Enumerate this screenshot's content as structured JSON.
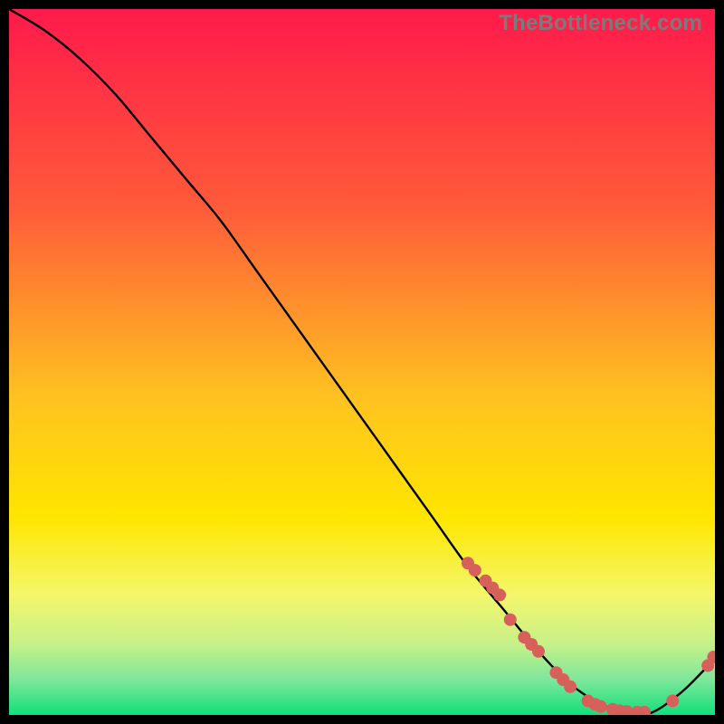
{
  "watermark": "TheBottleneck.com",
  "colors": {
    "gradient_top": "#ff1a4b",
    "gradient_mid1": "#ff6a33",
    "gradient_mid2": "#ffd400",
    "gradient_mid3": "#fff400",
    "gradient_bottom": "#10e07a",
    "curve": "#000000",
    "dot": "#d8605b"
  },
  "chart_data": {
    "type": "line",
    "title": "",
    "xlabel": "",
    "ylabel": "",
    "xlim": [
      0,
      100
    ],
    "ylim": [
      0,
      100
    ],
    "series": [
      {
        "name": "bottleneck-curve",
        "x": [
          0,
          5,
          10,
          15,
          20,
          25,
          30,
          35,
          40,
          45,
          50,
          55,
          60,
          65,
          70,
          75,
          80,
          85,
          90,
          95,
          100
        ],
        "y": [
          100,
          97,
          93,
          88,
          82,
          76,
          70,
          63,
          56,
          49,
          42,
          35,
          28,
          21,
          15,
          9,
          4,
          1,
          0,
          3,
          8
        ]
      }
    ],
    "markers": [
      {
        "x": 65.0,
        "y": 21.5
      },
      {
        "x": 66.0,
        "y": 20.5
      },
      {
        "x": 67.5,
        "y": 19.0
      },
      {
        "x": 68.5,
        "y": 18.0
      },
      {
        "x": 69.5,
        "y": 17.0
      },
      {
        "x": 71.0,
        "y": 13.5
      },
      {
        "x": 73.0,
        "y": 11.0
      },
      {
        "x": 74.0,
        "y": 10.0
      },
      {
        "x": 75.0,
        "y": 9.0
      },
      {
        "x": 77.5,
        "y": 6.0
      },
      {
        "x": 78.5,
        "y": 5.0
      },
      {
        "x": 79.5,
        "y": 4.0
      },
      {
        "x": 82.0,
        "y": 2.0
      },
      {
        "x": 83.0,
        "y": 1.5
      },
      {
        "x": 83.8,
        "y": 1.2
      },
      {
        "x": 85.5,
        "y": 0.8
      },
      {
        "x": 86.5,
        "y": 0.6
      },
      {
        "x": 87.5,
        "y": 0.5
      },
      {
        "x": 89.0,
        "y": 0.4
      },
      {
        "x": 90.0,
        "y": 0.4
      },
      {
        "x": 94.0,
        "y": 2.0
      },
      {
        "x": 99.0,
        "y": 7.0
      },
      {
        "x": 99.8,
        "y": 8.2
      }
    ]
  }
}
